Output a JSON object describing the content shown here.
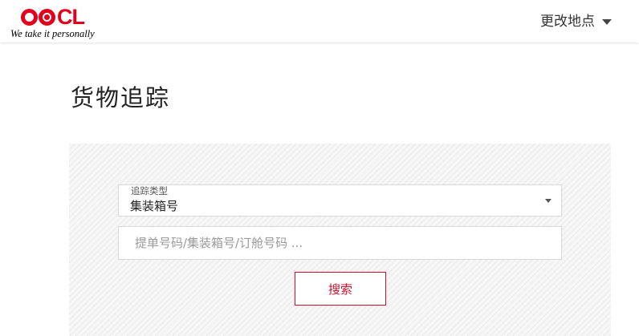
{
  "header": {
    "logo_text": "OOCL",
    "tagline": "We take it personally",
    "location_label": "更改地点"
  },
  "page": {
    "title": "货物追踪"
  },
  "search": {
    "type_label": "追踪类型",
    "type_value": "集装箱号",
    "input_placeholder": "提单号码/集装箱号/订舱号码 ...",
    "input_value": "",
    "button_label": "搜索"
  },
  "colors": {
    "brand_red": "#e2001a",
    "button_red": "#c8102e",
    "panel_bg": "#f6f6f6"
  },
  "icons": {
    "location_caret": "caret-down-icon",
    "select_caret": "chevron-down-icon"
  }
}
